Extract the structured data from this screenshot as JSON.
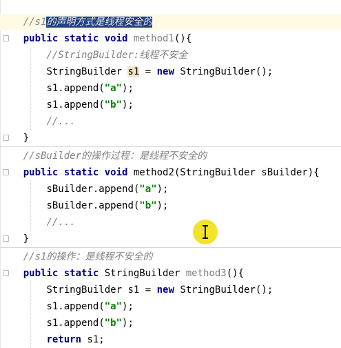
{
  "code": {
    "block1": {
      "comment_prefix": "//s1",
      "comment_selected": "的声明方式是线程安全的",
      "sig_kw": "public static void",
      "sig_method": " method1",
      "sig_rest": "(){",
      "inner_comment": "//StringBuilder:线程不安全",
      "decl_type": "StringBuilder ",
      "decl_var": "s1",
      "decl_eq": " = ",
      "decl_new": "new",
      "decl_ctor": " StringBuilder();",
      "append1_pre": "s1.append(",
      "append1_str": "\"a\"",
      "append1_post": ");",
      "append2_pre": "s1.append(",
      "append2_str": "\"b\"",
      "append2_post": ");",
      "ellipsis": "//...",
      "close": "}"
    },
    "block2": {
      "comment": "//sBuilder的操作过程：是线程不安全的",
      "sig_kw": "public static void",
      "sig_rest": " method2(StringBuilder sBuilder){",
      "append1_pre": "sBuilder.append(",
      "append1_str": "\"a\"",
      "append1_post": ");",
      "append2_pre": "sBuilder.append(",
      "append2_str": "\"b\"",
      "append2_post": ");",
      "ellipsis": "//...",
      "close": "}"
    },
    "block3": {
      "comment": "//s1的操作：是线程不安全的",
      "sig_kw": "public static",
      "sig_type": " StringBuilder ",
      "sig_method": "method3",
      "sig_rest": "(){",
      "decl_type": "StringBuilder s1 = ",
      "decl_new": "new",
      "decl_ctor": " StringBuilder();",
      "append1_pre": "s1.append(",
      "append1_str": "\"a\"",
      "append1_post": ");",
      "append2_pre": "s1.append(",
      "append2_str": "\"b\"",
      "append2_post": ");",
      "return_kw": "return",
      "return_rest": " s1;"
    }
  },
  "colors": {
    "keyword": "#000080",
    "comment": "#808080",
    "string": "#008000",
    "selection": "#214283",
    "cursor_highlight": "#f2e01a"
  }
}
